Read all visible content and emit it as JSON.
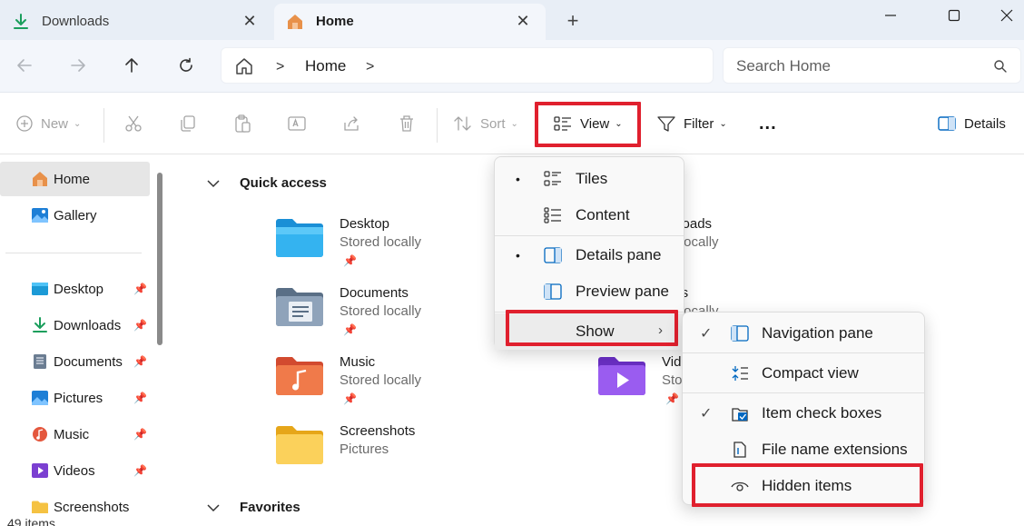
{
  "tabs": [
    {
      "label": "Downloads",
      "icon": "download-icon"
    },
    {
      "label": "Home",
      "icon": "home-icon"
    }
  ],
  "address": {
    "crumb": "Home"
  },
  "search": {
    "placeholder": "Search Home"
  },
  "toolbar": {
    "new_label": "New",
    "sort_label": "Sort",
    "view_label": "View",
    "filter_label": "Filter",
    "more_label": "...",
    "details_label": "Details"
  },
  "sidebar": {
    "items": [
      {
        "label": "Home",
        "icon": "home-icon"
      },
      {
        "label": "Gallery",
        "icon": "gallery-icon"
      },
      {
        "label": "Desktop",
        "icon": "desktop-folder-icon"
      },
      {
        "label": "Downloads",
        "icon": "download-icon"
      },
      {
        "label": "Documents",
        "icon": "documents-icon"
      },
      {
        "label": "Pictures",
        "icon": "pictures-icon"
      },
      {
        "label": "Music",
        "icon": "music-icon"
      },
      {
        "label": "Videos",
        "icon": "videos-icon"
      },
      {
        "label": "Screenshots",
        "icon": "folder-icon"
      }
    ],
    "status": "49 items"
  },
  "main": {
    "quick_access_title": "Quick access",
    "favorites_title": "Favorites",
    "quick_access": [
      {
        "name": "Desktop",
        "sub": "Stored locally"
      },
      {
        "name": "Documents",
        "sub": "Stored locally"
      },
      {
        "name": "Music",
        "sub": "Stored locally"
      },
      {
        "name": "Screenshots",
        "sub": "Pictures"
      },
      {
        "name": "wnloads",
        "sub": "ed locally"
      },
      {
        "name": "ures",
        "sub": "ed locally"
      },
      {
        "name": "Vid",
        "sub": "Sto"
      }
    ]
  },
  "view_menu": {
    "items": [
      {
        "label": "Tiles",
        "selected": true
      },
      {
        "label": "Content",
        "selected": false
      },
      {
        "label": "Details pane",
        "selected": true
      },
      {
        "label": "Preview pane",
        "selected": false
      },
      {
        "label": "Show"
      }
    ]
  },
  "show_menu": {
    "items": [
      {
        "label": "Navigation pane",
        "checked": true
      },
      {
        "label": "Compact view",
        "checked": false
      },
      {
        "label": "Item check boxes",
        "checked": true
      },
      {
        "label": "File name extensions",
        "checked": false
      },
      {
        "label": "Hidden items",
        "checked": false
      }
    ]
  },
  "colors": {
    "highlight": "#e0202e",
    "accent": "#0067c0"
  }
}
